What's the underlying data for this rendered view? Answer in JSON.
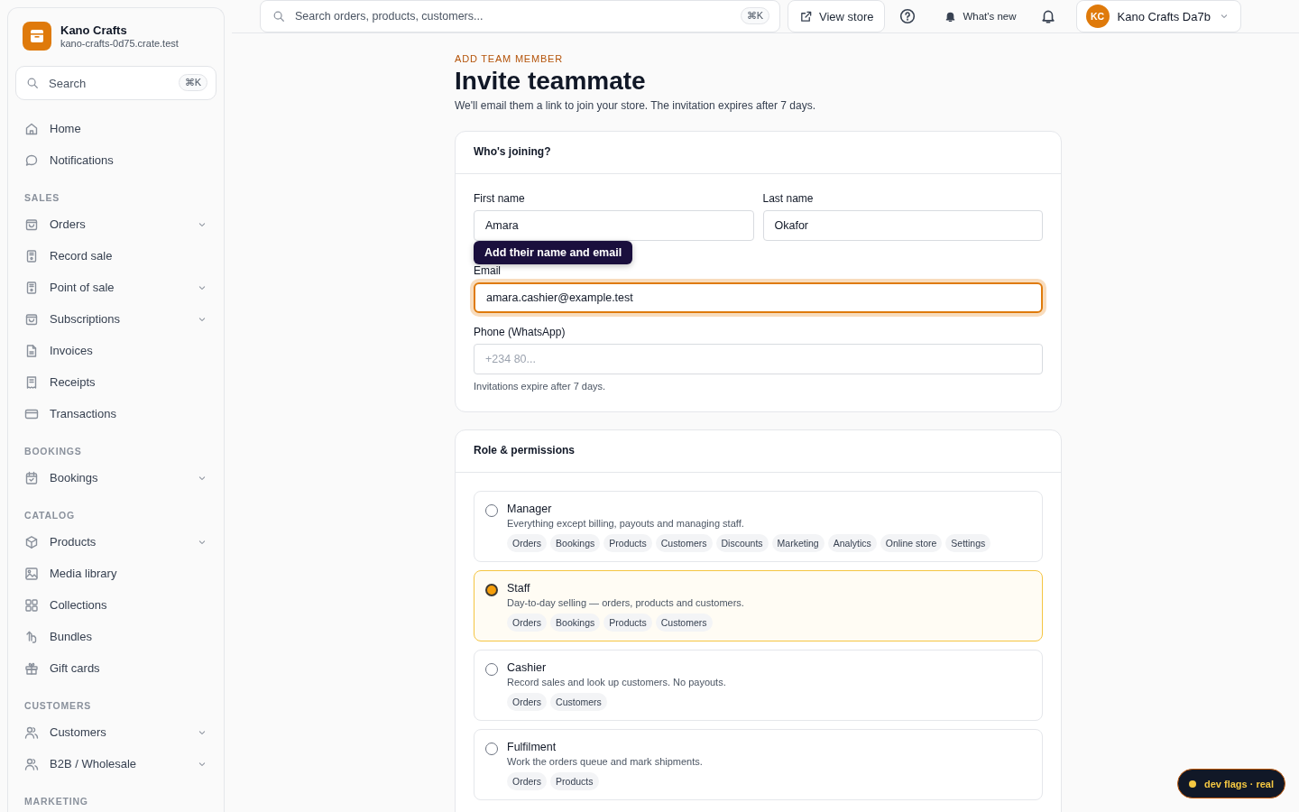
{
  "store": {
    "name": "Kano Crafts",
    "domain": "kano-crafts-0d75.crate.test"
  },
  "sidebar": {
    "search": {
      "placeholder": "Search",
      "shortcut": "⌘K"
    },
    "sections": [
      {
        "items": [
          {
            "label": "Home",
            "has_submenu": false
          },
          {
            "label": "Notifications",
            "has_submenu": false
          }
        ]
      },
      {
        "heading": "SALES",
        "items": [
          {
            "label": "Orders",
            "has_submenu": true
          },
          {
            "label": "Record sale",
            "has_submenu": false
          },
          {
            "label": "Point of sale",
            "has_submenu": true
          },
          {
            "label": "Subscriptions",
            "has_submenu": true
          },
          {
            "label": "Invoices",
            "has_submenu": false
          },
          {
            "label": "Receipts",
            "has_submenu": false
          },
          {
            "label": "Transactions",
            "has_submenu": false
          }
        ]
      },
      {
        "heading": "BOOKINGS",
        "items": [
          {
            "label": "Bookings",
            "has_submenu": true
          }
        ]
      },
      {
        "heading": "CATALOG",
        "items": [
          {
            "label": "Products",
            "has_submenu": true
          },
          {
            "label": "Media library",
            "has_submenu": false
          },
          {
            "label": "Collections",
            "has_submenu": false
          },
          {
            "label": "Bundles",
            "has_submenu": false
          },
          {
            "label": "Gift cards",
            "has_submenu": false
          }
        ]
      },
      {
        "heading": "CUSTOMERS",
        "items": [
          {
            "label": "Customers",
            "has_submenu": true
          },
          {
            "label": "B2B / Wholesale",
            "has_submenu": true
          }
        ]
      },
      {
        "heading": "MARKETING"
      }
    ]
  },
  "topbar": {
    "search": {
      "placeholder": "Search orders, products, customers...",
      "shortcut": "⌘K"
    },
    "view_store": "View store",
    "whats_new": "What's new",
    "account": {
      "initials": "KC",
      "name": "Kano Crafts Da7b"
    }
  },
  "page": {
    "eyebrow": "ADD TEAM MEMBER",
    "title": "Invite teammate",
    "subtitle": "We'll email them a link to join your store. The invitation expires after 7 days."
  },
  "details_card": {
    "title": "Who's joining?",
    "first_name": {
      "label": "First name",
      "value": "Amara"
    },
    "last_name": {
      "label": "Last name",
      "value": "Okafor"
    },
    "email": {
      "label": "Email",
      "value": "amara.cashier@example.test",
      "focused": true
    },
    "tooltip": "Add their name and email",
    "phone": {
      "label": "Phone (WhatsApp)",
      "placeholder": "+234 80..."
    },
    "hint": "Invitations expire after 7 days."
  },
  "roles_card": {
    "title": "Role & permissions",
    "roles": [
      {
        "name": "Manager",
        "description": "Everything except billing, payouts and managing staff.",
        "selected": false,
        "permissions": [
          "Orders",
          "Bookings",
          "Products",
          "Customers",
          "Discounts",
          "Marketing",
          "Analytics",
          "Online store",
          "Settings"
        ]
      },
      {
        "name": "Staff",
        "description": "Day-to-day selling — orders, products and customers.",
        "selected": true,
        "permissions": [
          "Orders",
          "Bookings",
          "Products",
          "Customers"
        ]
      },
      {
        "name": "Cashier",
        "description": "Record sales and look up customers. No payouts.",
        "selected": false,
        "permissions": [
          "Orders",
          "Customers"
        ]
      },
      {
        "name": "Fulfilment",
        "description": "Work the orders queue and mark shipments.",
        "selected": false,
        "permissions": [
          "Orders",
          "Products"
        ]
      }
    ]
  },
  "dev_badge": {
    "label": "dev flags · real",
    "color": "#f5c842"
  }
}
